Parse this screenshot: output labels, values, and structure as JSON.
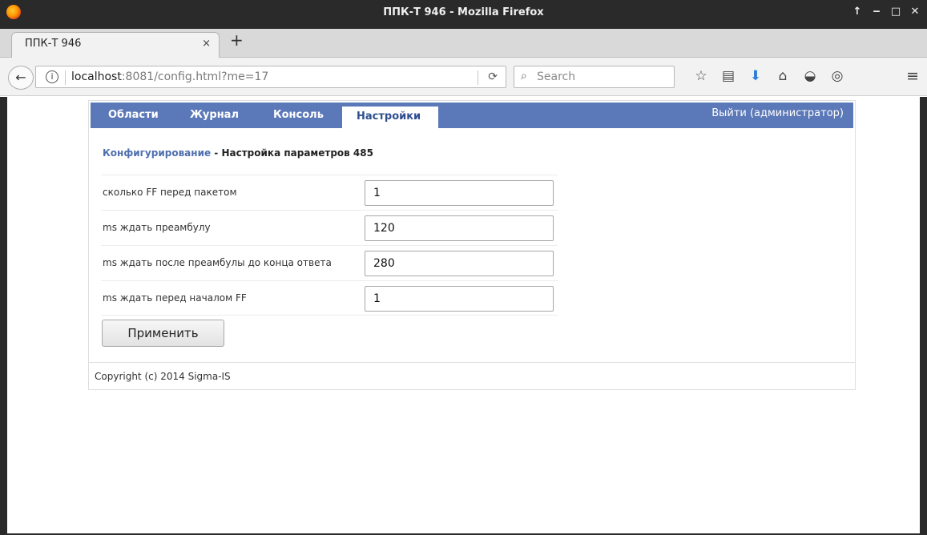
{
  "window": {
    "title": "ППК-Т 946 - Mozilla Firefox",
    "controls": [
      "↑",
      "‒",
      "□",
      "✕"
    ]
  },
  "tabs": [
    {
      "label": "ППК-Т 946",
      "close": "×"
    }
  ],
  "newtab": "+",
  "nav": {
    "back": "←",
    "info": "i",
    "url_host": "localhost",
    "url_rest": ":8081/config.html?me=17",
    "reload": "⟳",
    "search_placeholder": "Search",
    "search_icon": "🔍",
    "toolbar_icons": [
      "☆",
      "▤",
      "⬇",
      "⌂",
      "◒",
      "◎"
    ],
    "menu": "≡"
  },
  "app": {
    "menu": {
      "areas": "Области",
      "journal": "Журнал",
      "console": "Консоль",
      "settings": "Настройки",
      "logout": "Выйти (администратор)"
    },
    "breadcrumb": {
      "link": "Конфигурирование",
      "separator": " - ",
      "current": "Настройка параметров 485"
    },
    "fields": [
      {
        "label": "сколько FF перед пакетом",
        "value": "1"
      },
      {
        "label": "ms ждать преамбулу",
        "value": "120"
      },
      {
        "label": "ms ждать после преамбулы до конца ответа",
        "value": "280"
      },
      {
        "label": "ms ждать перед началом FF",
        "value": "1"
      }
    ],
    "apply_label": "Применить",
    "footer": "Copyright (c) 2014 Sigma-IS"
  },
  "colors": {
    "menubar": "#5b78b8",
    "link": "#4f6fae",
    "titlebar": "#2a2a2a"
  }
}
